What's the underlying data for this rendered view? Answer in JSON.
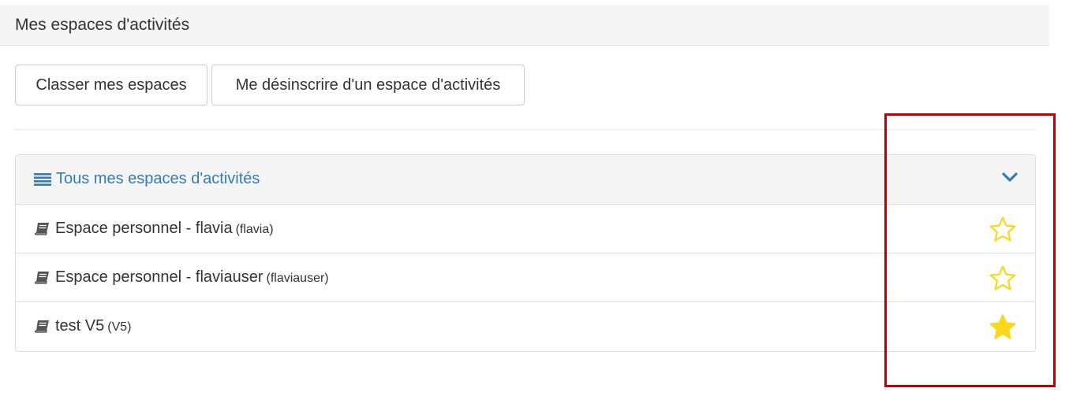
{
  "header": {
    "title": "Mes espaces d'activités"
  },
  "toolbar": {
    "sort_label": "Classer mes espaces",
    "unsubscribe_label": "Me désinscrire d'un espace d'activités"
  },
  "panel": {
    "title": "Tous mes espaces d'activités",
    "icon": "list-icon",
    "collapse_icon": "chevron-down-icon",
    "items": [
      {
        "name": "Espace personnel - flavia",
        "code": "(flavia)",
        "icon": "book-icon",
        "favorite": false
      },
      {
        "name": "Espace personnel - flaviauser",
        "code": "(flaviauser)",
        "icon": "book-icon",
        "favorite": false
      },
      {
        "name": "test V5",
        "code": "(V5)",
        "icon": "book-icon",
        "favorite": true
      }
    ]
  },
  "colors": {
    "link": "#337ab7",
    "star": "#f9d71c",
    "highlight": "#c00000"
  }
}
